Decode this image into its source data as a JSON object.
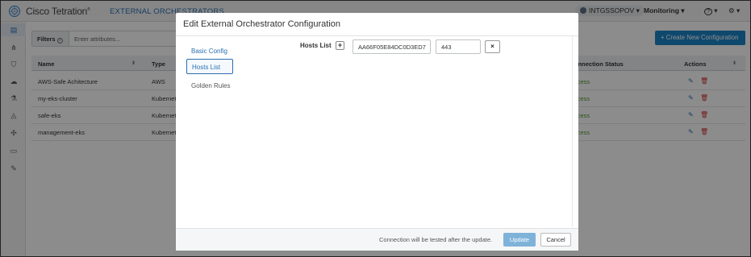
{
  "header": {
    "brand": "Cisco Tetration",
    "brand_mark": "®",
    "app_title": "EXTERNAL ORCHESTRATORS",
    "scope": "INTGSSOPOV",
    "monitoring": "Monitoring",
    "help": "?",
    "settings": "⚙"
  },
  "sidebar": {
    "items": [
      {
        "icon": "dashboard-icon"
      },
      {
        "icon": "topology-icon"
      },
      {
        "icon": "shield-icon"
      },
      {
        "icon": "cloud-icon"
      },
      {
        "icon": "flask-icon"
      },
      {
        "icon": "bell-icon"
      },
      {
        "icon": "plugin-icon"
      },
      {
        "icon": "monitor-icon"
      },
      {
        "icon": "wrench-icon"
      }
    ]
  },
  "main": {
    "filters_label": "Filters",
    "filters_placeholder": "Enter attributes...",
    "create_button": "+ Create New Configuration",
    "columns": [
      "Name",
      "Type",
      "onnection Status",
      "Actions"
    ],
    "rows": [
      {
        "name": "AWS-Safe Achitecture",
        "type": "AWS",
        "status": "ccess"
      },
      {
        "name": "my-eks-cluster",
        "type": "Kubernet",
        "status": "ccess"
      },
      {
        "name": "safe-eks",
        "type": "Kubernet",
        "status": "ccess"
      },
      {
        "name": "management-eks",
        "type": "Kubernet",
        "status": "ccess"
      }
    ]
  },
  "modal": {
    "title": "Edit External Orchestrator Configuration",
    "nav": [
      "Basic Config",
      "Hosts List",
      "Golden Rules"
    ],
    "active_nav": "Hosts List",
    "hosts_label": "Hosts List",
    "plus": "+",
    "host_value": "AA66F05E84DC0D3ED7",
    "port_value": "443",
    "remove": "×",
    "footer_note": "Connection will be tested after the update.",
    "update_button": "Update",
    "cancel_button": "Cancel"
  },
  "colors": {
    "accent": "#2a6fb0",
    "primary_button": "#1d84c6",
    "disabled_primary": "#7fb2d9",
    "success": "#4c9a2a",
    "danger": "#d43030"
  }
}
